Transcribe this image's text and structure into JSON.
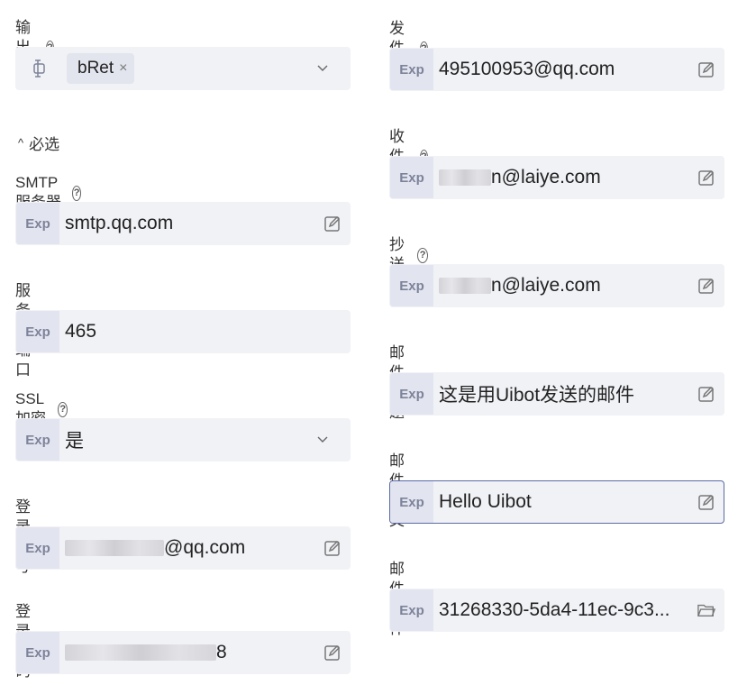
{
  "left": {
    "output": {
      "label": "输出到",
      "tag": "bRet",
      "tag_remove": "×"
    },
    "section_toggle": {
      "caret": "^",
      "label": "必选"
    },
    "smtp": {
      "label": "SMTP服务器",
      "exp": "Exp",
      "value": "smtp.qq.com"
    },
    "port": {
      "label": "服务器端口",
      "exp": "Exp",
      "value": "465"
    },
    "ssl": {
      "label": "SSL加密",
      "exp": "Exp",
      "value": "是"
    },
    "account": {
      "label": "登录帐号",
      "exp": "Exp",
      "value_suffix": "@qq.com"
    },
    "password": {
      "label": "登录密码",
      "exp": "Exp",
      "value_suffix": "8"
    }
  },
  "right": {
    "sender": {
      "label": "发件人",
      "exp": "Exp",
      "value": "495100953@qq.com"
    },
    "recipient": {
      "label": "收件人",
      "exp": "Exp",
      "value_suffix": "n@laiye.com"
    },
    "cc": {
      "label": "抄送",
      "exp": "Exp",
      "value_suffix": "n@laiye.com"
    },
    "subject": {
      "label": "邮件标题",
      "exp": "Exp",
      "value": "这是用Uibot发送的邮件"
    },
    "body": {
      "label": "邮件正文",
      "exp": "Exp",
      "value": "Hello Uibot"
    },
    "attachment": {
      "label": "邮件附件",
      "exp": "Exp",
      "value": "31268330-5da4-11ec-9c3..."
    }
  },
  "help_glyph": "?",
  "icons": {
    "edit": "edit-icon",
    "chevron": "chevron-down-icon",
    "folder": "folder-icon",
    "output": "output-variable-icon",
    "help": "help-icon"
  }
}
